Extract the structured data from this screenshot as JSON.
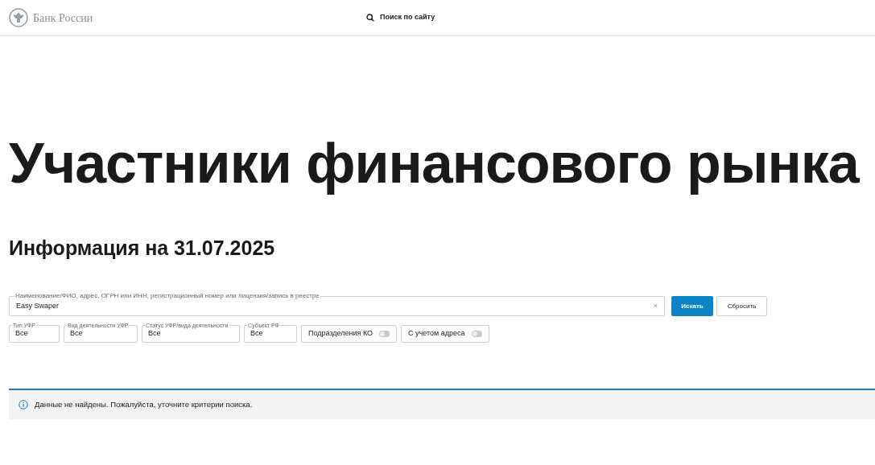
{
  "header": {
    "logo_text": "Банк России",
    "search_label": "Поиск по сайту"
  },
  "title": "Участники финансового рынка",
  "subtitle": "Информация на 31.07.2025",
  "search": {
    "label": "Наименование/ФИО, адрес, ОГРН или ИНН, регистрационный номер или лицензия/запись в реестре",
    "value": "Easy Swaper",
    "clear": "×",
    "submit": "Искать",
    "reset": "Сбросить"
  },
  "filters": [
    {
      "kind": "select",
      "label": "Тип УФР",
      "value": "Все"
    },
    {
      "kind": "select",
      "label": "Вид деятельности УФР",
      "value": "Все"
    },
    {
      "kind": "select",
      "label": "Статус УФР/вида деятельности",
      "value": "Все"
    },
    {
      "kind": "select",
      "label": "Субъект РФ",
      "value": "Все"
    },
    {
      "kind": "toggle",
      "label": "Подразделения КО",
      "on": false
    },
    {
      "kind": "toggle",
      "label": "С учетом адреса",
      "on": false
    }
  ],
  "message": "Данные не найдены. Пожалуйста, уточните критерии поиска."
}
